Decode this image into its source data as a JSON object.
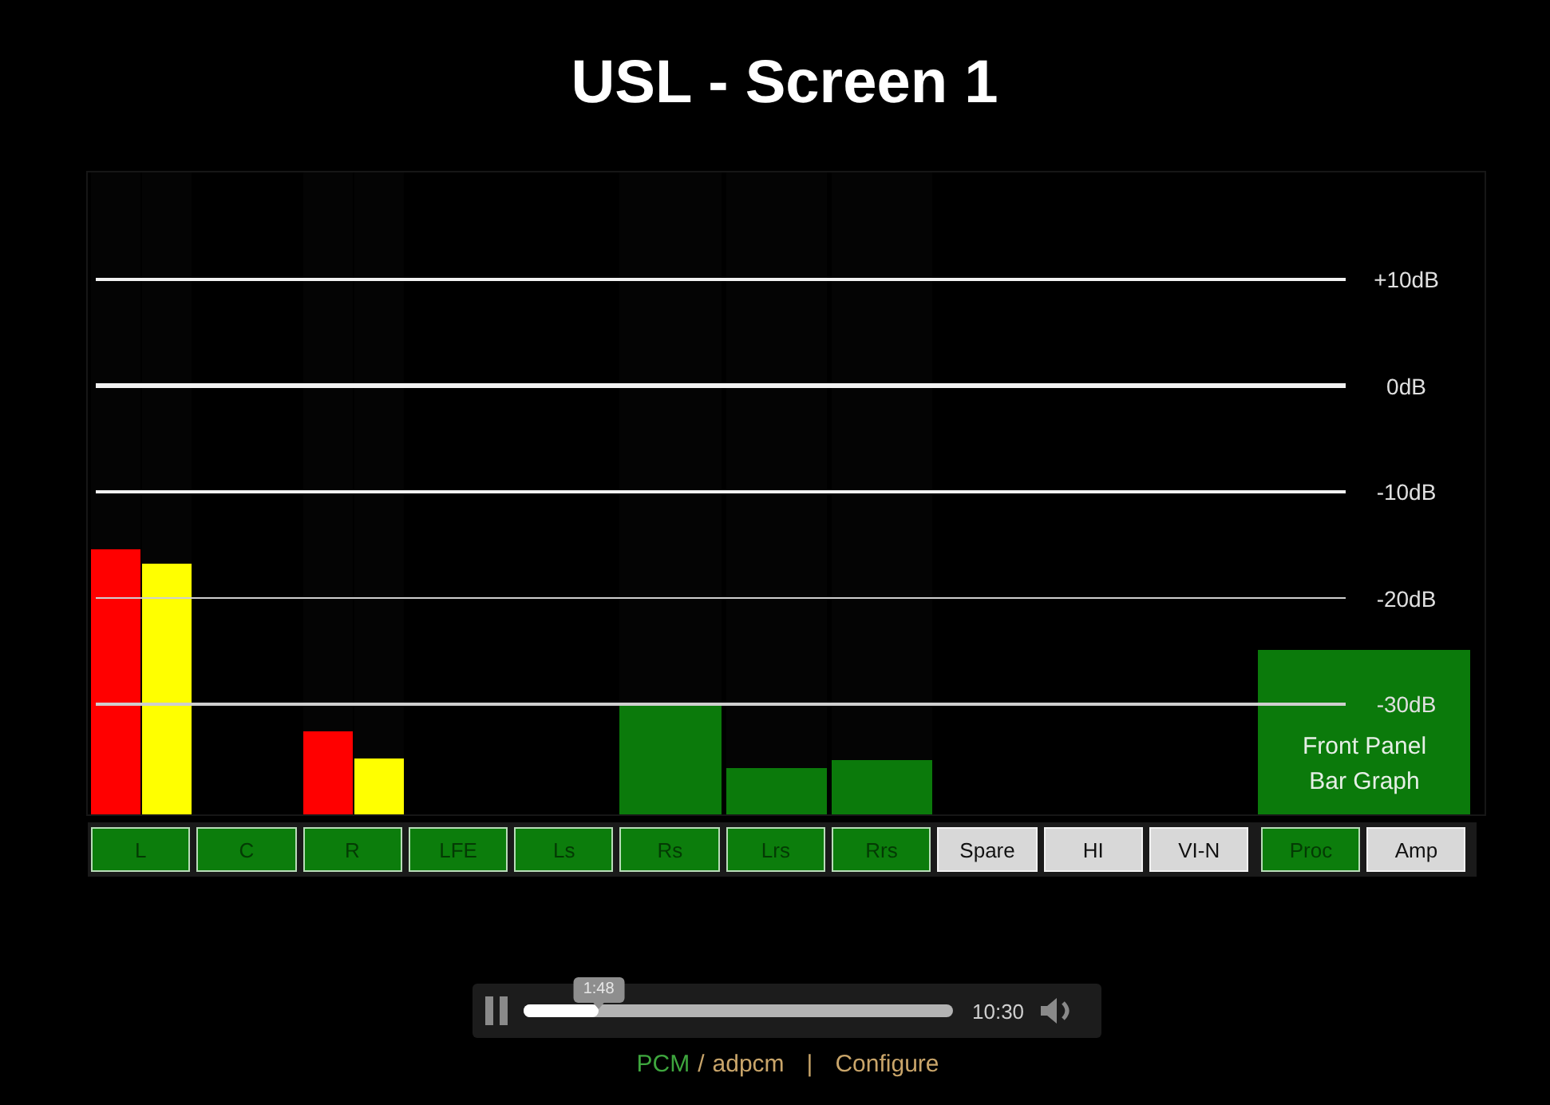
{
  "title": "USL - Screen 1",
  "scale": [
    "+10dB",
    "0dB",
    "-10dB",
    "-20dB",
    "-30dB"
  ],
  "front_panel": {
    "label": "Front Panel Bar Graph"
  },
  "channels": [
    {
      "label": "L",
      "on": true,
      "meters": [
        {
          "color": "#ff0000",
          "level": 0.413
        },
        {
          "color": "#ffff00",
          "level": 0.39
        }
      ]
    },
    {
      "label": "C",
      "on": true
    },
    {
      "label": "R",
      "on": true,
      "meters": [
        {
          "color": "#ff0000",
          "level": 0.129
        },
        {
          "color": "#ffff00",
          "level": 0.087
        }
      ]
    },
    {
      "label": "LFE",
      "on": true
    },
    {
      "label": "Ls",
      "on": true
    },
    {
      "label": "Rs",
      "on": true,
      "meters": [
        {
          "color": "#0b7a0b",
          "level": 0.172
        }
      ]
    },
    {
      "label": "Lrs",
      "on": true,
      "meters": [
        {
          "color": "#0b7a0b",
          "level": 0.072
        }
      ]
    },
    {
      "label": "Rrs",
      "on": true,
      "meters": [
        {
          "color": "#0b7a0b",
          "level": 0.085
        }
      ]
    },
    {
      "label": "Spare",
      "on": false
    },
    {
      "label": "HI",
      "on": false
    },
    {
      "label": "VI-N",
      "on": false
    }
  ],
  "outputs": [
    {
      "label": "Proc",
      "on": true
    },
    {
      "label": "Amp",
      "on": false
    }
  ],
  "player": {
    "playing": true,
    "progress": {
      "level": 0.175
    },
    "tooltip": "1:48",
    "duration": "10:30"
  },
  "footer": {
    "formats": [
      {
        "label": "PCM",
        "selected": true
      },
      {
        "label": "adpcm",
        "selected": false
      }
    ],
    "format_separator": "/",
    "separator": "|",
    "configure": "Configure"
  }
}
